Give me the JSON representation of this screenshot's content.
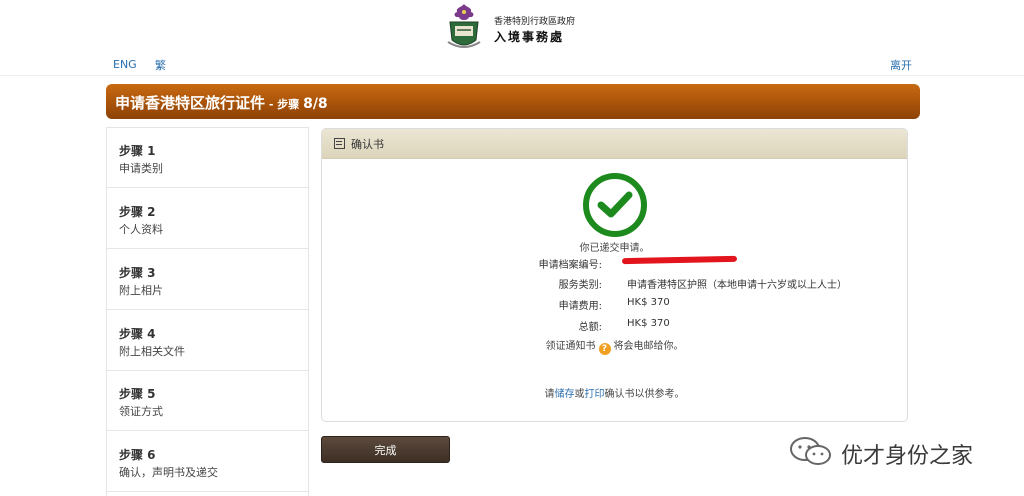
{
  "header": {
    "org_line1": "香港特別行政區政府",
    "org_line2": "入境事務處",
    "lang_eng": "ENG",
    "lang_tc": "繁",
    "leave": "离开"
  },
  "title": {
    "main": "申请香港特区旅行证件",
    "step_prefix": " - 步骤 ",
    "step_num": "8/8"
  },
  "sidebar": {
    "steps": [
      {
        "title": "步骤 1",
        "desc": "申请类别"
      },
      {
        "title": "步骤 2",
        "desc": "个人资料"
      },
      {
        "title": "步骤 3",
        "desc": "附上相片"
      },
      {
        "title": "步骤 4",
        "desc": "附上相关文件"
      },
      {
        "title": "步骤 5",
        "desc": "领证方式"
      },
      {
        "title": "步骤 6",
        "desc": "确认，声明书及递交"
      }
    ]
  },
  "panel": {
    "title": "确认书",
    "submitted": "你已递交申请。",
    "rows": [
      {
        "label": "申请档案编号:",
        "value": ""
      },
      {
        "label": "服务类别:",
        "value": "申请香港特区护照（本地申请十六岁或以上人士）"
      },
      {
        "label": "申请费用:",
        "value": "HK$ 370"
      },
      {
        "label": "总额:",
        "value": "HK$ 370"
      }
    ],
    "notice_pre": "领证通知书",
    "notice_post": "将会电邮给你。",
    "save_pre": "请",
    "save_link": "储存",
    "save_mid": "或",
    "print_link": "打印",
    "save_post": "确认书以供参考。"
  },
  "actions": {
    "finish": "完成"
  },
  "watermark": {
    "text": "优才身份之家"
  },
  "colors": {
    "title_bar": "#a9530a",
    "check": "#1d8a1d",
    "link": "#2a6fb0",
    "redaction": "#e2141c"
  }
}
